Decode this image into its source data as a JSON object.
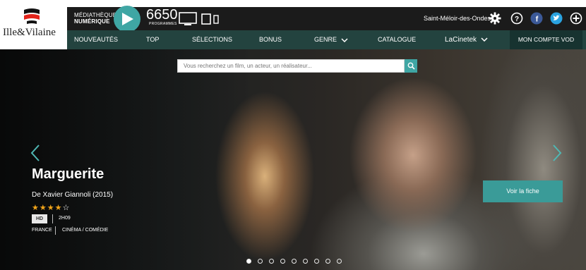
{
  "logo": {
    "text": "Ille&Vilaine",
    "icon": "ille-et-vilaine-logo"
  },
  "topbar": {
    "mediatheque_line1": "MÉDIATHÈQUE",
    "mediatheque_line2": "NUMÉRIQUE",
    "programs_count": "6650",
    "programs_label": "PROGRAMMES",
    "library_name": "Saint-Méloir-des-Ondes",
    "icons": [
      "play-icon",
      "monitor-icon",
      "tablet-icon",
      "phone-icon",
      "gear-icon",
      "help-icon",
      "facebook-icon",
      "twitter-icon",
      "plus-icon"
    ]
  },
  "nav": {
    "items": [
      "NOUVEAUTÉS",
      "TOP",
      "SÉLECTIONS",
      "BONUS",
      "GENRE",
      "CATALOGUE",
      "LaCinetek"
    ],
    "account": "MON COMPTE VOD"
  },
  "search": {
    "placeholder": "Vous recherchez un film, un acteur, un réalisateur..."
  },
  "hero": {
    "title": "Marguerite",
    "byline": "De Xavier Giannoli (2015)",
    "rating": 4,
    "rating_max": 5,
    "stars_filled": "★★★★",
    "stars_empty": "☆",
    "badge": "HD",
    "duration": "2H09",
    "country": "FRANCE",
    "genre": "CINÉMA / COMÉDIE",
    "cta": "Voir la fiche"
  },
  "carousel": {
    "slide_count": 9,
    "active_index": 0
  },
  "colors": {
    "accent": "#3fa6a4",
    "nav_bg": "#23433f",
    "topbar_bg": "#1b1b1b",
    "star": "#f2a51a"
  }
}
